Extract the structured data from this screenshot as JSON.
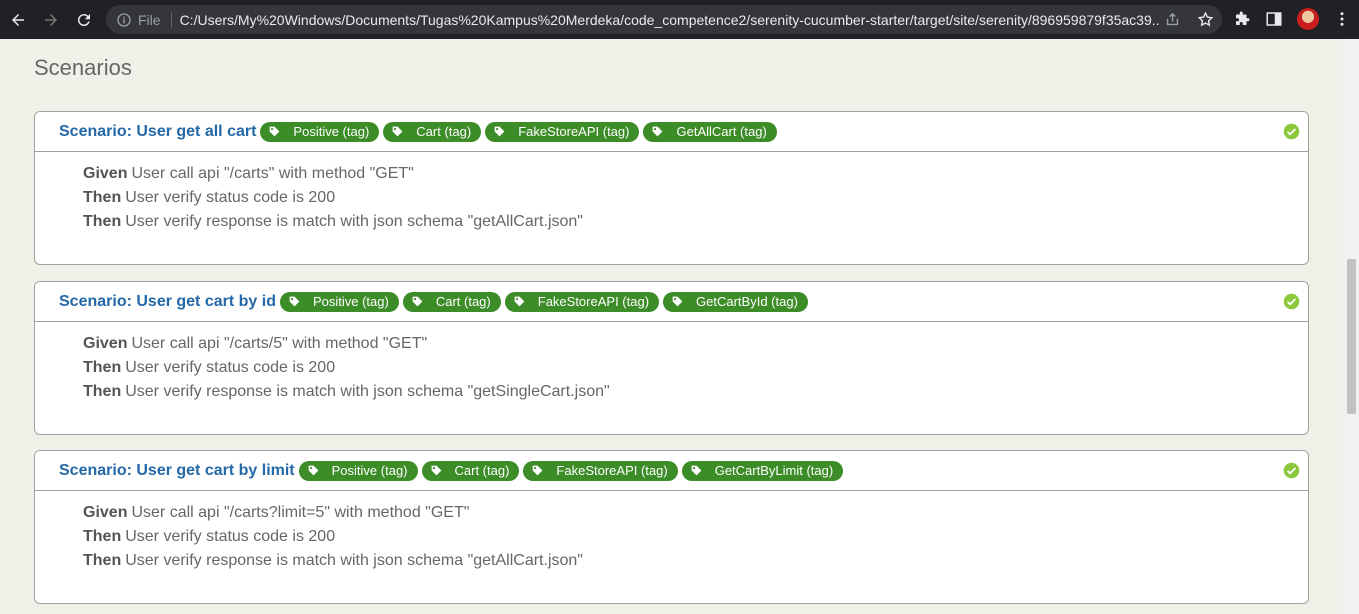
{
  "browser": {
    "file_label": "File",
    "url": "C:/Users/My%20Windows/Documents/Tugas%20Kampus%20Merdeka/code_competence2/serenity-cucumber-starter/target/site/serenity/896959879f35ac39..."
  },
  "page": {
    "title": "Scenarios"
  },
  "scenarios": [
    {
      "title": "Scenario: User get all cart",
      "tags": [
        "Positive (tag)",
        "Cart (tag)",
        "FakeStoreAPI (tag)",
        "GetAllCart (tag)"
      ],
      "steps": [
        {
          "keyword": "Given",
          "text": "User call api \"/carts\" with method \"GET\""
        },
        {
          "keyword": "Then",
          "text": "User verify status code is 200"
        },
        {
          "keyword": "Then",
          "text": "User verify response is match with json schema \"getAllCart.json\""
        }
      ]
    },
    {
      "title": "Scenario: User get cart by id",
      "tags": [
        "Positive (tag)",
        "Cart (tag)",
        "FakeStoreAPI (tag)",
        "GetCartById (tag)"
      ],
      "steps": [
        {
          "keyword": "Given",
          "text": "User call api \"/carts/5\" with method \"GET\""
        },
        {
          "keyword": "Then",
          "text": "User verify status code is 200"
        },
        {
          "keyword": "Then",
          "text": "User verify response is match with json schema \"getSingleCart.json\""
        }
      ]
    },
    {
      "title": "Scenario: User get cart by limit",
      "tags": [
        "Positive (tag)",
        "Cart (tag)",
        "FakeStoreAPI (tag)",
        "GetCartByLimit (tag)"
      ],
      "steps": [
        {
          "keyword": "Given",
          "text": "User call api \"/carts?limit=5\" with method \"GET\""
        },
        {
          "keyword": "Then",
          "text": "User verify status code is 200"
        },
        {
          "keyword": "Then",
          "text": "User verify response is match with json schema \"getAllCart.json\""
        }
      ]
    }
  ],
  "colors": {
    "tag": "#3c8c28",
    "title": "#2468a8",
    "passed": "#8cc83c"
  },
  "icons": {
    "tag": "tag-icon",
    "status": "check-circle-icon"
  }
}
